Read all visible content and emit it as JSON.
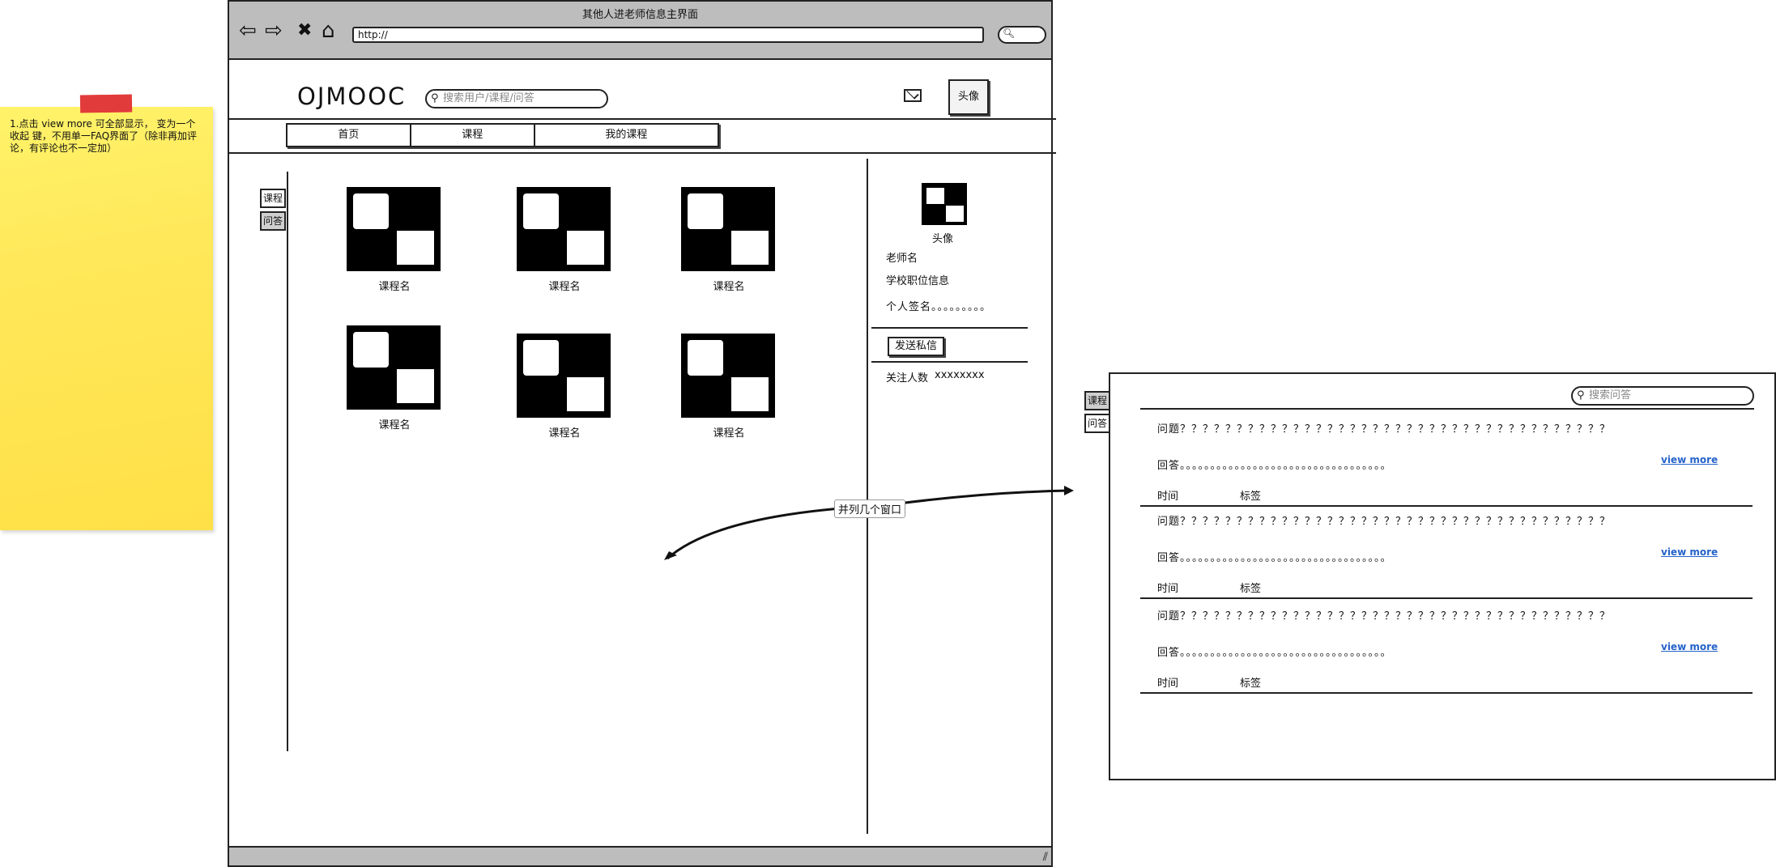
{
  "sticky_note": {
    "text": "1.点击 view more 可全部显示， 变为一个收起 键，不用单一FAQ界面了（除非再加评论，有评论也不一定加）"
  },
  "browser": {
    "title": "其他人进老师信息主界面",
    "url": "http://"
  },
  "header": {
    "logo": "OJMOOC",
    "search_placeholder": "搜索用户/课程/问答",
    "avatar_label": "头像"
  },
  "nav_tabs": [
    "首页",
    "课程",
    "我的课程"
  ],
  "side_tabs": [
    "课程",
    "问答"
  ],
  "courses": [
    "课程名",
    "课程名",
    "课程名",
    "课程名",
    "课程名",
    "课程名"
  ],
  "teacher": {
    "avatar_label": "头像",
    "name": "老师名",
    "school": "学校职位信息",
    "signature": "个人签名。。。。。。。。。",
    "send_message": "发送私信",
    "followers_label": "关注人数",
    "followers_value": "xxxxxxxx"
  },
  "annotation": "并列几个窗口",
  "faq": {
    "side_tabs": [
      "课程",
      "问答"
    ],
    "search_placeholder": "搜索问答",
    "items": [
      {
        "question": "问题？？？？？？？？？？？？？？？？？？？？？？？？？？？？？？？？？？？？？？",
        "answer": "回答。。。。。。。。。。。。。。。。。。。。。。。。。。。。。。。。。。",
        "time": "时间",
        "tag": "标签",
        "view_more": "view more"
      },
      {
        "question": "问题？？？？？？？？？？？？？？？？？？？？？？？？？？？？？？？？？？？？？？",
        "answer": "回答。。。。。。。。。。。。。。。。。。。。。。。。。。。。。。。。。。",
        "time": "时间",
        "tag": "标签",
        "view_more": "view more"
      },
      {
        "question": "问题？？？？？？？？？？？？？？？？？？？？？？？？？？？？？？？？？？？？？？",
        "answer": "回答。。。。。。。。。。。。。。。。。。。。。。。。。。。。。。。。。。",
        "time": "时间",
        "tag": "标签",
        "view_more": "view more"
      }
    ]
  },
  "colors": {
    "sticky": "#ffe85a",
    "tape": "#e23b3b",
    "chrome": "#bdbdbd",
    "link": "#2563c9"
  }
}
